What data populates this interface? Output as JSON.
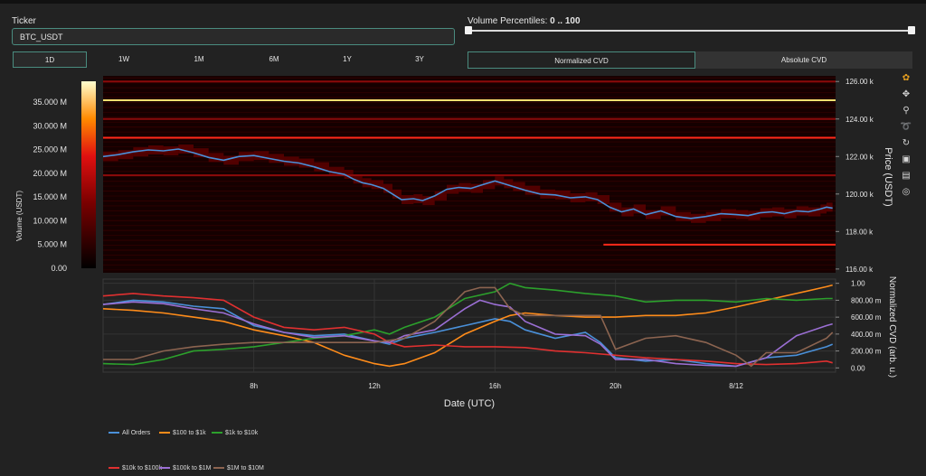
{
  "ticker": {
    "label": "Ticker",
    "value": "BTC_USDT"
  },
  "volume_percentiles": {
    "label": "Volume Percentiles:",
    "range_text": "0 .. 100",
    "low": 0,
    "high": 100
  },
  "timeframes": [
    {
      "label": "1D",
      "active": true
    },
    {
      "label": "1W",
      "active": false
    },
    {
      "label": "1M",
      "active": false
    },
    {
      "label": "6M",
      "active": false
    },
    {
      "label": "1Y",
      "active": false
    },
    {
      "label": "3Y",
      "active": false
    }
  ],
  "cvd_modes": [
    {
      "label": "Normalized CVD",
      "active": true
    },
    {
      "label": "Absolute CVD",
      "active": false
    }
  ],
  "toolbar": [
    "plotly-logo-icon",
    "pan-icon",
    "zoom-icon",
    "lasso-icon",
    "autoscale-icon",
    "download-icon",
    "spike-lines-icon",
    "hover-icon"
  ],
  "colorbar": {
    "title": "Volume (USDT)",
    "ticks": [
      "35.000 M",
      "30.000 M",
      "25.000 M",
      "20.000 M",
      "15.000 M",
      "10.000 M",
      "5.000 M",
      "0.00"
    ]
  },
  "chart_data": [
    {
      "type": "heatmap",
      "title": "",
      "xlabel": "",
      "ylabel": "Price (USDT)",
      "ylim": [
        115800,
        126300
      ],
      "y_ticks": [
        "126.00 k",
        "124.00 k",
        "122.00 k",
        "120.00 k",
        "118.00 k",
        "116.00 k"
      ],
      "y_tick_values": [
        126000,
        124000,
        122000,
        120000,
        118000,
        116000
      ],
      "x_range_hours": [
        3,
        27.3
      ],
      "price_line_color": "#4a90d9",
      "price_series": [
        [
          3.0,
          122000
        ],
        [
          3.5,
          122100
        ],
        [
          4.0,
          122250
        ],
        [
          4.5,
          122350
        ],
        [
          5.0,
          122300
        ],
        [
          5.5,
          122400
        ],
        [
          6.0,
          122200
        ],
        [
          6.5,
          121950
        ],
        [
          7.0,
          121800
        ],
        [
          7.5,
          122000
        ],
        [
          8.0,
          122050
        ],
        [
          8.5,
          121900
        ],
        [
          9.0,
          121750
        ],
        [
          9.5,
          121650
        ],
        [
          10.0,
          121450
        ],
        [
          10.5,
          121200
        ],
        [
          11.0,
          121050
        ],
        [
          11.3,
          120800
        ],
        [
          11.6,
          120600
        ],
        [
          11.9,
          120500
        ],
        [
          12.3,
          120300
        ],
        [
          12.6,
          120000
        ],
        [
          12.9,
          119700
        ],
        [
          13.3,
          119750
        ],
        [
          13.6,
          119650
        ],
        [
          14.0,
          119900
        ],
        [
          14.4,
          120250
        ],
        [
          14.8,
          120350
        ],
        [
          15.2,
          120300
        ],
        [
          15.6,
          120500
        ],
        [
          16.0,
          120700
        ],
        [
          16.3,
          120550
        ],
        [
          16.6,
          120400
        ],
        [
          17.0,
          120200
        ],
        [
          17.5,
          120000
        ],
        [
          18.0,
          119950
        ],
        [
          18.5,
          119800
        ],
        [
          19.0,
          119850
        ],
        [
          19.4,
          119700
        ],
        [
          19.8,
          119300
        ],
        [
          20.2,
          119050
        ],
        [
          20.6,
          119200
        ],
        [
          21.0,
          118900
        ],
        [
          21.5,
          119100
        ],
        [
          22.0,
          118800
        ],
        [
          22.5,
          118700
        ],
        [
          23.0,
          118800
        ],
        [
          23.5,
          118950
        ],
        [
          24.0,
          118900
        ],
        [
          24.4,
          118850
        ],
        [
          24.8,
          119000
        ],
        [
          25.2,
          119050
        ],
        [
          25.6,
          118950
        ],
        [
          26.0,
          119100
        ],
        [
          26.4,
          119050
        ],
        [
          26.8,
          119200
        ],
        [
          27.0,
          119300
        ],
        [
          27.2,
          119250
        ]
      ],
      "volume_bands": [
        {
          "price": 125000,
          "volume": 35000000
        },
        {
          "price": 123000,
          "volume": 22000000
        },
        {
          "price": 117300,
          "volume": 20000000
        },
        {
          "price": 126000,
          "volume": 9000000
        },
        {
          "price": 124000,
          "volume": 7000000
        },
        {
          "price": 121000,
          "volume": 5000000
        }
      ]
    },
    {
      "type": "line",
      "title": "",
      "xlabel": "Date (UTC)",
      "ylabel": "Normalized CVD (arb. u.)",
      "ylim": [
        -0.05,
        1.05
      ],
      "y_ticks": [
        "1.00",
        "800.00 m",
        "600.00 m",
        "400.00 m",
        "200.00 m",
        "0.00"
      ],
      "y_tick_values": [
        1.0,
        0.8,
        0.6,
        0.4,
        0.2,
        0.0
      ],
      "x_ticks": [
        "8h",
        "12h",
        "16h",
        "20h",
        "8/12"
      ],
      "x_tick_values": [
        8,
        12,
        16,
        20,
        24
      ],
      "x_range_hours": [
        3,
        27.3
      ],
      "series": [
        {
          "name": "All Orders",
          "color": "#4a90d9",
          "points": [
            [
              3,
              0.75
            ],
            [
              4,
              0.8
            ],
            [
              5,
              0.78
            ],
            [
              6,
              0.73
            ],
            [
              7,
              0.7
            ],
            [
              8,
              0.5
            ],
            [
              9,
              0.42
            ],
            [
              10,
              0.38
            ],
            [
              11,
              0.4
            ],
            [
              12,
              0.32
            ],
            [
              12.5,
              0.28
            ],
            [
              13,
              0.35
            ],
            [
              14,
              0.42
            ],
            [
              15,
              0.5
            ],
            [
              16,
              0.58
            ],
            [
              16.5,
              0.55
            ],
            [
              17,
              0.45
            ],
            [
              18,
              0.35
            ],
            [
              19,
              0.42
            ],
            [
              19.5,
              0.3
            ],
            [
              20,
              0.12
            ],
            [
              21,
              0.08
            ],
            [
              22,
              0.1
            ],
            [
              23,
              0.05
            ],
            [
              24,
              0.02
            ],
            [
              25,
              0.12
            ],
            [
              26,
              0.15
            ],
            [
              27,
              0.25
            ],
            [
              27.2,
              0.28
            ]
          ]
        },
        {
          "name": "$100 to $1k",
          "color": "#ff8c1a",
          "points": [
            [
              3,
              0.7
            ],
            [
              4,
              0.68
            ],
            [
              5,
              0.65
            ],
            [
              6,
              0.6
            ],
            [
              7,
              0.55
            ],
            [
              8,
              0.45
            ],
            [
              9,
              0.38
            ],
            [
              10,
              0.3
            ],
            [
              11,
              0.15
            ],
            [
              12,
              0.05
            ],
            [
              12.5,
              0.02
            ],
            [
              13,
              0.05
            ],
            [
              14,
              0.18
            ],
            [
              15,
              0.4
            ],
            [
              16,
              0.55
            ],
            [
              16.5,
              0.62
            ],
            [
              17,
              0.65
            ],
            [
              18,
              0.62
            ],
            [
              19,
              0.6
            ],
            [
              20,
              0.6
            ],
            [
              21,
              0.62
            ],
            [
              22,
              0.62
            ],
            [
              23,
              0.65
            ],
            [
              24,
              0.72
            ],
            [
              25,
              0.8
            ],
            [
              26,
              0.88
            ],
            [
              27,
              0.96
            ],
            [
              27.2,
              0.98
            ]
          ]
        },
        {
          "name": "$1k to $10k",
          "color": "#2ca02c",
          "points": [
            [
              3,
              0.05
            ],
            [
              4,
              0.04
            ],
            [
              5,
              0.1
            ],
            [
              6,
              0.2
            ],
            [
              7,
              0.22
            ],
            [
              8,
              0.25
            ],
            [
              9,
              0.3
            ],
            [
              10,
              0.35
            ],
            [
              11,
              0.38
            ],
            [
              12,
              0.45
            ],
            [
              12.5,
              0.4
            ],
            [
              13,
              0.48
            ],
            [
              14,
              0.6
            ],
            [
              15,
              0.82
            ],
            [
              16,
              0.9
            ],
            [
              16.5,
              1.0
            ],
            [
              17,
              0.95
            ],
            [
              18,
              0.92
            ],
            [
              19,
              0.88
            ],
            [
              20,
              0.85
            ],
            [
              21,
              0.78
            ],
            [
              22,
              0.8
            ],
            [
              23,
              0.8
            ],
            [
              24,
              0.78
            ],
            [
              25,
              0.82
            ],
            [
              26,
              0.8
            ],
            [
              27,
              0.82
            ],
            [
              27.2,
              0.82
            ]
          ]
        },
        {
          "name": "$10k to $100k",
          "color": "#e03030",
          "points": [
            [
              3,
              0.85
            ],
            [
              4,
              0.88
            ],
            [
              5,
              0.85
            ],
            [
              6,
              0.83
            ],
            [
              7,
              0.8
            ],
            [
              8,
              0.6
            ],
            [
              9,
              0.48
            ],
            [
              10,
              0.45
            ],
            [
              11,
              0.48
            ],
            [
              12,
              0.4
            ],
            [
              12.5,
              0.3
            ],
            [
              13,
              0.25
            ],
            [
              14,
              0.27
            ],
            [
              15,
              0.25
            ],
            [
              16,
              0.25
            ],
            [
              17,
              0.24
            ],
            [
              18,
              0.2
            ],
            [
              19,
              0.18
            ],
            [
              20,
              0.15
            ],
            [
              21,
              0.12
            ],
            [
              22,
              0.1
            ],
            [
              23,
              0.08
            ],
            [
              24,
              0.05
            ],
            [
              25,
              0.04
            ],
            [
              26,
              0.05
            ],
            [
              27,
              0.08
            ],
            [
              27.2,
              0.06
            ]
          ]
        },
        {
          "name": "$100k to $1M",
          "color": "#9b6fd4",
          "points": [
            [
              3,
              0.75
            ],
            [
              4,
              0.78
            ],
            [
              5,
              0.76
            ],
            [
              6,
              0.7
            ],
            [
              7,
              0.65
            ],
            [
              8,
              0.52
            ],
            [
              9,
              0.42
            ],
            [
              10,
              0.36
            ],
            [
              11,
              0.38
            ],
            [
              12,
              0.32
            ],
            [
              12.5,
              0.3
            ],
            [
              13,
              0.38
            ],
            [
              14,
              0.45
            ],
            [
              15,
              0.7
            ],
            [
              15.5,
              0.8
            ],
            [
              16,
              0.75
            ],
            [
              16.5,
              0.72
            ],
            [
              17,
              0.55
            ],
            [
              18,
              0.4
            ],
            [
              19,
              0.38
            ],
            [
              19.5,
              0.28
            ],
            [
              20,
              0.1
            ],
            [
              21,
              0.1
            ],
            [
              22,
              0.05
            ],
            [
              23,
              0.03
            ],
            [
              24,
              0.02
            ],
            [
              25,
              0.12
            ],
            [
              26,
              0.38
            ],
            [
              27,
              0.5
            ],
            [
              27.2,
              0.52
            ]
          ]
        },
        {
          "name": "$1M to $10M",
          "color": "#8c6450",
          "points": [
            [
              3,
              0.1
            ],
            [
              4,
              0.1
            ],
            [
              5,
              0.2
            ],
            [
              6,
              0.25
            ],
            [
              7,
              0.28
            ],
            [
              8,
              0.3
            ],
            [
              9,
              0.3
            ],
            [
              10,
              0.3
            ],
            [
              11,
              0.3
            ],
            [
              12,
              0.3
            ],
            [
              13,
              0.35
            ],
            [
              14,
              0.55
            ],
            [
              15,
              0.9
            ],
            [
              15.5,
              0.95
            ],
            [
              16,
              0.95
            ],
            [
              16.5,
              0.7
            ],
            [
              17,
              0.62
            ],
            [
              18,
              0.62
            ],
            [
              19,
              0.62
            ],
            [
              19.5,
              0.62
            ],
            [
              20,
              0.22
            ],
            [
              21,
              0.35
            ],
            [
              22,
              0.38
            ],
            [
              23,
              0.3
            ],
            [
              24,
              0.15
            ],
            [
              24.5,
              0.02
            ],
            [
              25,
              0.18
            ],
            [
              26,
              0.18
            ],
            [
              27,
              0.35
            ],
            [
              27.2,
              0.42
            ]
          ]
        }
      ]
    }
  ]
}
